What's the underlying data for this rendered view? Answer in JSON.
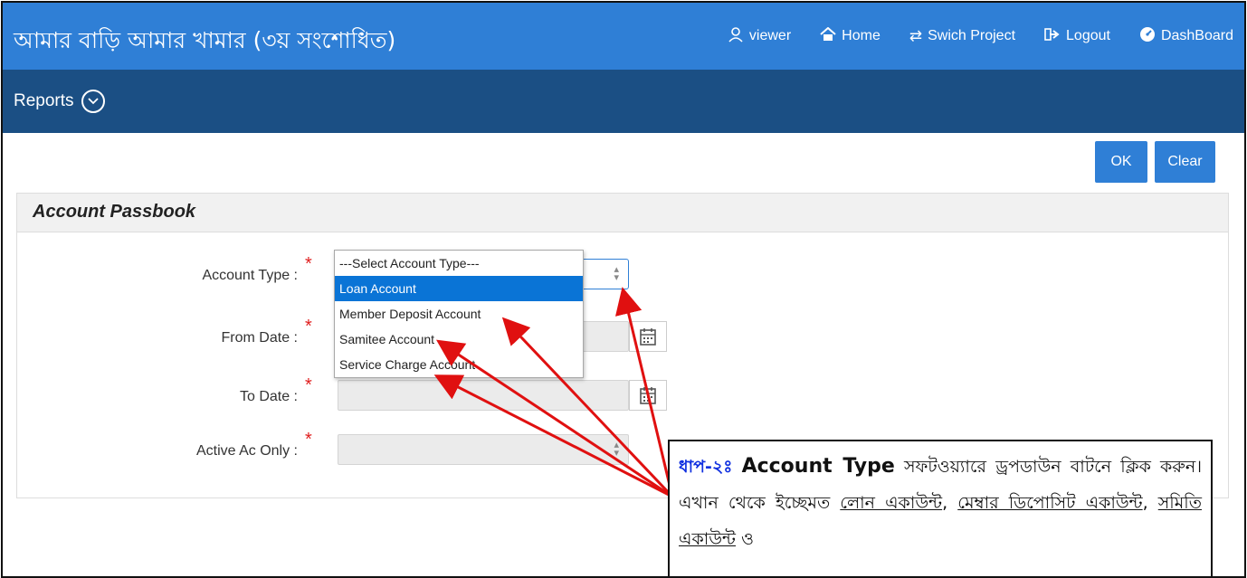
{
  "app_title": "আমার বাড়ি আমার খামার (৩য় সংশোধিত)",
  "nav": {
    "viewer": "viewer",
    "home": "Home",
    "switch_project": "Swich Project",
    "logout": "Logout",
    "dashboard": "DashBoard"
  },
  "subnav": {
    "reports": "Reports"
  },
  "buttons": {
    "ok": "OK",
    "clear": "Clear"
  },
  "panel": {
    "title": "Account Passbook",
    "fields": {
      "account_type": "Account Type :",
      "from_date": "From Date :",
      "to_date": "To Date :",
      "active_ac_only": "Active Ac Only :"
    },
    "required_mark": "*"
  },
  "dropdown": {
    "options": [
      "---Select Account Type---",
      "Loan Account",
      "Member Deposit Account",
      "Samitee Account",
      "Service Charge Account"
    ],
    "selected": "Loan Account"
  },
  "callout": {
    "step": "ধাপ-২ঃ",
    "keyword": "Account Type",
    "text1": "সফটওয়্যারে ড্রপডাউন বাটনে ক্লিক করুন। এখান থেকে ইচ্ছেমত",
    "loan": "লোন একাউন্ট",
    "comma1": ", ",
    "member_deposit": "মেম্বার ডিপোসিট একাউন্ট",
    "comma2": ", ",
    "samity": "সমিতি একাউন্ট",
    "and": " ও"
  },
  "colors": {
    "topbar": "#2f7fd6",
    "subbar": "#1b4f84",
    "accent": "#2f7fd6",
    "arrow": "#e01010",
    "selected_option": "#0a74d6"
  }
}
